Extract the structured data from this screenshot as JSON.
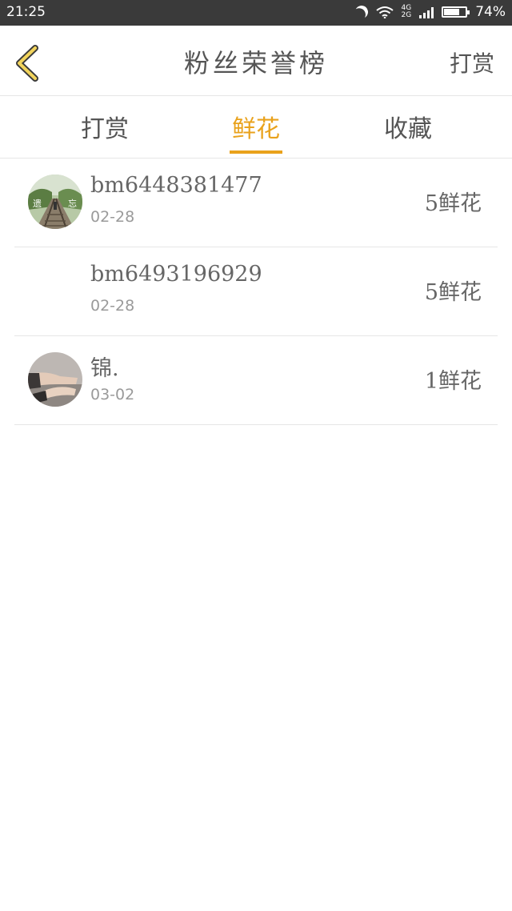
{
  "status_bar": {
    "time": "21:25",
    "network": [
      "4G",
      "2G"
    ],
    "battery_percent": "74%",
    "battery_level": 0.74
  },
  "header": {
    "title": "粉丝荣誉榜",
    "action_label": "打赏",
    "accent_color": "#e9a21c"
  },
  "tabs": [
    {
      "label": "打赏",
      "active": false
    },
    {
      "label": "鲜花",
      "active": true
    },
    {
      "label": "收藏",
      "active": false
    }
  ],
  "list": [
    {
      "name": "bm6448381477",
      "date": "02-28",
      "amount": "5鲜花",
      "avatar": "railway-photo"
    },
    {
      "name": "bm6493196929",
      "date": "02-28",
      "amount": "5鲜花",
      "avatar": "none"
    },
    {
      "name": "锦.",
      "date": "03-02",
      "amount": "1鲜花",
      "avatar": "hands-photo"
    }
  ]
}
